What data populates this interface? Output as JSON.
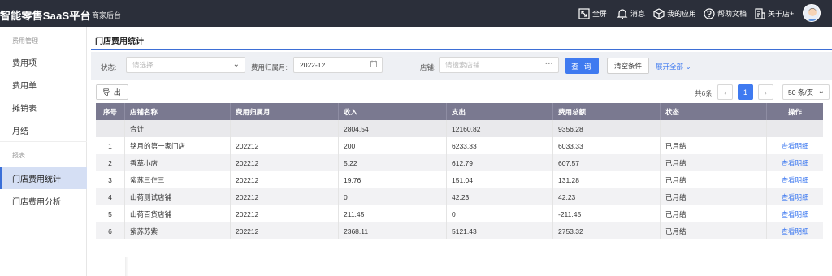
{
  "header": {
    "brand": "智能零售SaaS平台",
    "subtitle": "商家后台",
    "tools": [
      {
        "label": "全屏",
        "icon": "fullscreen-icon"
      },
      {
        "label": "消息",
        "icon": "bell-icon"
      },
      {
        "label": "我的应用",
        "icon": "apps-icon"
      },
      {
        "label": "帮助文档",
        "icon": "help-icon"
      },
      {
        "label": "关于店+",
        "icon": "about-icon"
      }
    ]
  },
  "sidebar": {
    "group1": "费用管理",
    "items1": [
      "费用项",
      "费用单",
      "摊销表",
      "月结"
    ],
    "group2": "报表",
    "items2": [
      "门店费用统计",
      "门店费用分析"
    ],
    "active": "门店费用统计"
  },
  "page": {
    "title": "门店费用统计"
  },
  "filters": {
    "status_label": "状态:",
    "status_placeholder": "请选择",
    "month_label": "费用归属月:",
    "month_value": "2022-12",
    "store_label": "店铺:",
    "store_placeholder": "请搜索店铺",
    "store_more": "···",
    "query": "查 询",
    "clear": "清空条件",
    "expand": "展开全部"
  },
  "toolbar": {
    "export": "导 出",
    "total": "共6条",
    "current_page": "1",
    "page_size": "50 条/页"
  },
  "table": {
    "columns": [
      "序号",
      "店铺名称",
      "费用归属月",
      "收入",
      "支出",
      "费用总额",
      "状态",
      "操作"
    ],
    "summary": {
      "label": "合计",
      "income": "2804.54",
      "expense": "12160.82",
      "total": "9356.28"
    },
    "rows": [
      {
        "no": "1",
        "store": "铭月的第一家门店",
        "month": "202212",
        "income": "200",
        "expense": "6233.33",
        "total": "6033.33",
        "status": "已月结",
        "action": "查看明细"
      },
      {
        "no": "2",
        "store": "香草小店",
        "month": "202212",
        "income": "5.22",
        "expense": "612.79",
        "total": "607.57",
        "status": "已月结",
        "action": "查看明细"
      },
      {
        "no": "3",
        "store": "紫苏三仨三",
        "month": "202212",
        "income": "19.76",
        "expense": "151.04",
        "total": "131.28",
        "status": "已月结",
        "action": "查看明细"
      },
      {
        "no": "4",
        "store": "山荷测试店铺",
        "month": "202212",
        "income": "0",
        "expense": "42.23",
        "total": "42.23",
        "status": "已月结",
        "action": "查看明细"
      },
      {
        "no": "5",
        "store": "山荷百货店铺",
        "month": "202212",
        "income": "211.45",
        "expense": "0",
        "total": "-211.45",
        "status": "已月结",
        "action": "查看明细"
      },
      {
        "no": "6",
        "store": "紫苏苏紫",
        "month": "202212",
        "income": "2368.11",
        "expense": "5121.43",
        "total": "2753.32",
        "status": "已月结",
        "action": "查看明细"
      }
    ]
  }
}
